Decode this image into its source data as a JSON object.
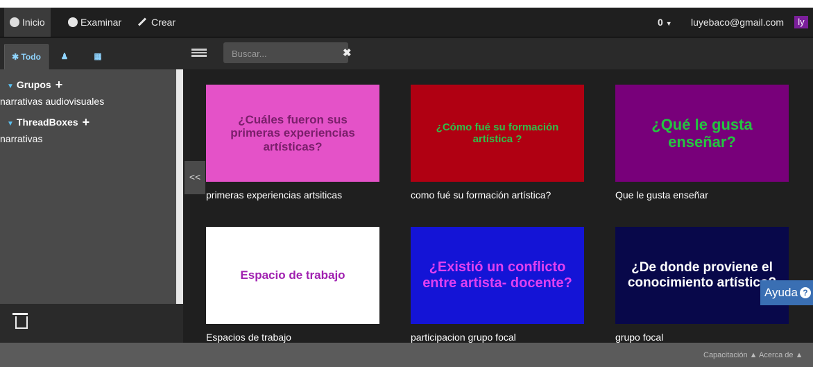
{
  "navbar": {
    "inicio": "Inicio",
    "examinar": "Examinar",
    "crear": "Crear",
    "count": "0",
    "email": "luyebaco@gmail.com",
    "avatar": "ly"
  },
  "sidebar": {
    "tabs": {
      "todo": "Todo"
    },
    "grupos_label": "Grupos",
    "grupos_items": [
      "narrativas audiovisuales"
    ],
    "threadboxes_label": "ThreadBoxes",
    "threadboxes_items": [
      "narrativas"
    ]
  },
  "search": {
    "placeholder": "Buscar..."
  },
  "collapse_label": "<<",
  "cards": [
    {
      "thumb_text": "¿Cuáles fueron sus primeras experiencias artísticas?",
      "label": "primeras experiencias artsiticas",
      "bg": "#e452c8",
      "fg": "#7a1f6b"
    },
    {
      "thumb_text": "¿Cómo fué  su formación artística ?",
      "label": "como fué su formación artística?",
      "bg": "#b00012",
      "fg": "#2fbf4a"
    },
    {
      "thumb_text": "¿Qué le gusta enseñar?",
      "label": "Que le gusta enseñar",
      "bg": "#78007a",
      "fg": "#24c540"
    },
    {
      "thumb_text": "Espacio de trabajo",
      "label": "Espacios de trabajo",
      "bg": "#ffffff",
      "fg": "#a020b0"
    },
    {
      "thumb_text": "¿Existió  un conflicto entre artista- docente?",
      "label": "participacion grupo focal",
      "bg": "#1414d6",
      "fg": "#e040f0"
    },
    {
      "thumb_text": "¿De donde proviene el conocimiento artístico?",
      "label": "grupo focal",
      "bg": "#08084a",
      "fg": "#ffffff"
    }
  ],
  "help": "Ayuda",
  "footer": {
    "capacitacion": "Capacitación",
    "acerca": "Acerca de"
  }
}
